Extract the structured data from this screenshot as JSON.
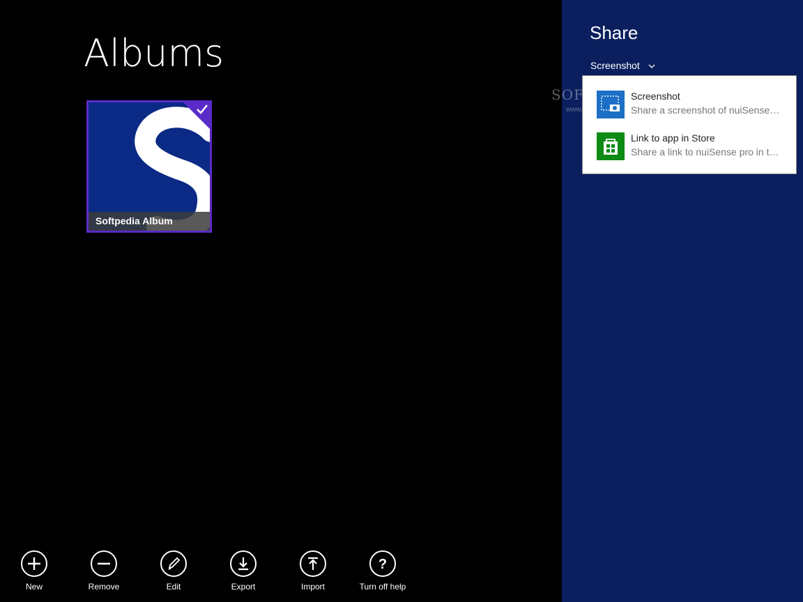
{
  "page": {
    "title": "Albums"
  },
  "albums": [
    {
      "name": "Softpedia Album",
      "selected": true
    }
  ],
  "appbar": {
    "buttons": [
      {
        "label": "New",
        "icon": "plus-icon"
      },
      {
        "label": "Remove",
        "icon": "minus-icon"
      },
      {
        "label": "Edit",
        "icon": "pencil-icon"
      },
      {
        "label": "Export",
        "icon": "download-icon"
      },
      {
        "label": "Import",
        "icon": "upload-icon"
      },
      {
        "label": "Turn off help",
        "icon": "question-icon"
      }
    ]
  },
  "share": {
    "title": "Share",
    "dropdown_value": "Screenshot",
    "watermark": "SOFTPEDIA",
    "watermark_sub": "www.softpedia.com",
    "options": [
      {
        "title": "Screenshot",
        "subtitle": "Share a screenshot of nuiSense…",
        "icon": "screenshot-icon",
        "color": "#1c6fc5"
      },
      {
        "title": "Link to app in Store",
        "subtitle": "Share a link to nuiSense pro in t…",
        "icon": "store-icon",
        "color": "#0e8a16"
      }
    ]
  },
  "colors": {
    "selection": "#5b2bc9",
    "charm_bg": "#0b1f5e",
    "tile_bg": "#0a2a85"
  }
}
